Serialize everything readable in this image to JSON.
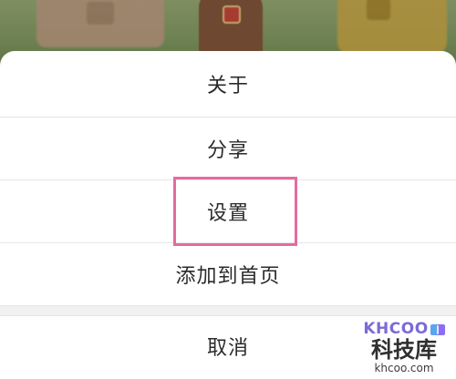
{
  "menu": {
    "items": [
      {
        "label": "关于"
      },
      {
        "label": "分享"
      },
      {
        "label": "设置"
      },
      {
        "label": "添加到首页"
      }
    ],
    "cancel_label": "取消"
  },
  "watermark": {
    "logo_text": "KHCOO",
    "brand_text": "科技库",
    "domain_text": "khcoo.com"
  },
  "colors": {
    "highlight": "#e56aa1",
    "sheet_bg": "#ffffff",
    "text": "#2b2b2b"
  },
  "icons": {
    "background": [
      "gift-icon"
    ],
    "watermark": [
      "book-icon"
    ]
  }
}
